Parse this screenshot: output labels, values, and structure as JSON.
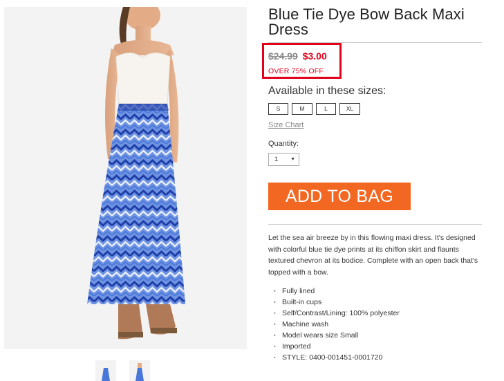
{
  "product": {
    "title": "Blue Tie Dye Bow Back Maxi Dress",
    "price_original": "$24.99",
    "price_sale": "$3.00",
    "discount_text": "OVER 75% OFF",
    "sizes_label": "Available in these sizes:",
    "sizes": [
      "S",
      "M",
      "L",
      "XL"
    ],
    "size_chart_label": "Size Chart",
    "quantity_label": "Quantity:",
    "quantity_value": "1",
    "add_to_bag_label": "ADD TO BAG",
    "description": "Let the sea air breeze by in this flowing maxi dress. It's designed with colorful blue tie dye prints at its chiffon skirt and flaunts textured chevron at its bodice. Complete with an open back that's topped with a bow.",
    "features": [
      "Fully lined",
      "Built-in cups",
      "Self/Contrast/Lining: 100% polyester",
      "Machine wash",
      "Model wears size Small",
      "Imported",
      "STYLE: 0400-001451-0001720"
    ]
  },
  "colors": {
    "sale_red": "#e3001b",
    "add_to_bag_orange": "#f26722",
    "dress_blue": "#3f6fd1"
  },
  "icons": {
    "qty_caret": "▼"
  }
}
